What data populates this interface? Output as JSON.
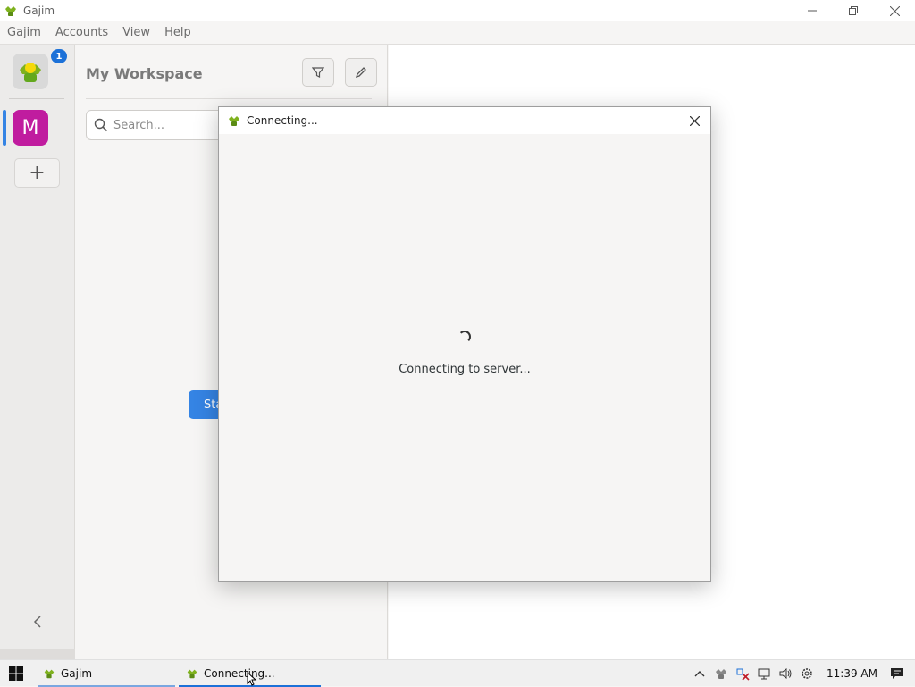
{
  "window": {
    "title": "Gajim",
    "controls": [
      "minimize-icon",
      "restore-icon",
      "close-icon"
    ]
  },
  "menu": [
    "Gajim",
    "Accounts",
    "View",
    "Help"
  ],
  "rail": {
    "notification_count": "1",
    "workspace_letter": "M",
    "workspace_color": "#c01c9f",
    "add_label": "+",
    "collapse_label": "‹"
  },
  "workspace": {
    "title": "My Workspace",
    "search_placeholder": "Search...",
    "start_button_partial": "Sta"
  },
  "dialog": {
    "title": "Connecting...",
    "message": "Connecting to server..."
  },
  "taskbar": {
    "items": [
      {
        "label": "Gajim"
      },
      {
        "label": "Connecting..."
      }
    ],
    "clock": "11:39 AM"
  },
  "colors": {
    "accent": "#3584e4",
    "workspace": "#c01c9f"
  }
}
